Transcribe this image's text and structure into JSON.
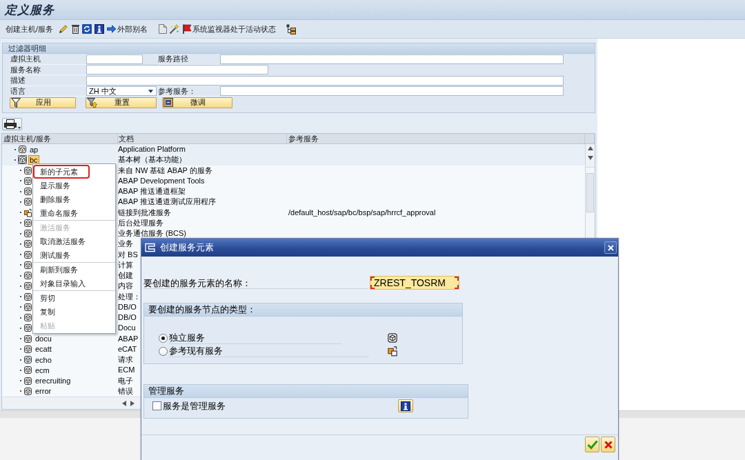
{
  "window": {
    "title": "定义服务"
  },
  "toolbar": {
    "create": "创建主机/服务",
    "external_alias": "外部别名",
    "monitor_status": "系统监视器处于活动状态"
  },
  "filter": {
    "title": "过滤器明细",
    "virtual_host": {
      "label": "虚拟主机"
    },
    "service_path": {
      "label": "服务路径"
    },
    "service_name": {
      "label": "服务名称"
    },
    "description": {
      "label": "描述"
    },
    "language": {
      "label": "语言",
      "value": "ZH 中文"
    },
    "reference_service": {
      "label": "参考服务："
    },
    "buttons": [
      {
        "kind": "apply",
        "label": "应用"
      },
      {
        "kind": "reset",
        "label": "重置"
      },
      {
        "kind": "tune",
        "label": "微调"
      }
    ]
  },
  "tree": {
    "columns": [
      "虚拟主机/服务",
      "文档",
      "参考服务"
    ],
    "rows": [
      {
        "name": "ap",
        "doc": "Application Platform",
        "kind": "service",
        "selected": false
      },
      {
        "name": "bc",
        "doc": "基本树（基本功能）",
        "kind": "service",
        "selected": true,
        "children": [
          {
            "kind": "service",
            "doc": "来自 NW 基础 ABAP 的服务",
            "selected": false
          },
          {
            "kind": "service",
            "doc": "ABAP Development Tools",
            "selected": false
          },
          {
            "kind": "service",
            "doc": "ABAP 推送通道框架",
            "selected": false
          },
          {
            "kind": "service",
            "doc": "ABAP 推送通道测试应用程序",
            "selected": false
          },
          {
            "kind": "reference",
            "doc": "链接到批准服务",
            "reference": "/default_host/sap/bc/bsp/sap/hrrcf_approval",
            "selected": false
          },
          {
            "kind": "service",
            "doc": "后台处理服务",
            "selected": false
          },
          {
            "kind": "service",
            "doc": "业务通信服务 (BCS)",
            "selected": false
          },
          {
            "kind": "service",
            "doc": "业务",
            "selected": false
          },
          {
            "kind": "service",
            "doc": "对 BS",
            "selected": false
          },
          {
            "kind": "service",
            "doc": "计算",
            "selected": false
          },
          {
            "kind": "service",
            "doc": "创建",
            "selected": false
          },
          {
            "kind": "service",
            "doc": "内容",
            "selected": false
          },
          {
            "kind": "service",
            "doc": "处理：",
            "selected": false
          },
          {
            "kind": "service",
            "doc": "DB/O",
            "selected": false
          },
          {
            "kind": "service",
            "doc": "DB/O",
            "selected": false
          },
          {
            "kind": "service",
            "doc": "Docu",
            "selected": false
          },
          {
            "name": "docu",
            "kind": "service",
            "doc": "ABAP",
            "selected": false
          },
          {
            "name": "ecatt",
            "kind": "service",
            "doc": "eCAT",
            "selected": false
          },
          {
            "name": "echo",
            "kind": "service",
            "doc": "请求",
            "selected": false
          },
          {
            "name": "ecm",
            "kind": "service",
            "doc": "ECM",
            "selected": false
          },
          {
            "name": "erecruiting",
            "kind": "service",
            "doc": "电子",
            "selected": false
          },
          {
            "name": "error",
            "kind": "service",
            "doc": "错误",
            "selected": false
          }
        ]
      }
    ]
  },
  "context_menu": {
    "groups": [
      [
        {
          "label": "新的子元素",
          "disabled": false,
          "selected": true
        },
        {
          "label": "显示服务",
          "disabled": false,
          "selected": false
        },
        {
          "label": "删除服务",
          "disabled": false,
          "selected": false
        },
        {
          "label": "重命名服务",
          "disabled": false,
          "selected": false
        }
      ],
      [
        {
          "label": "激活服务",
          "disabled": true,
          "selected": false
        },
        {
          "label": "取消激活服务",
          "disabled": false,
          "selected": false
        },
        {
          "label": "测试服务",
          "disabled": false,
          "selected": false
        }
      ],
      [
        {
          "label": "刷新到服务",
          "disabled": false,
          "selected": false
        },
        {
          "label": "对象目录输入",
          "disabled": false,
          "selected": false
        }
      ],
      [
        {
          "label": "剪切",
          "disabled": false,
          "selected": false
        },
        {
          "label": "复制",
          "disabled": false,
          "selected": false
        },
        {
          "label": "粘贴",
          "disabled": true,
          "selected": false
        }
      ]
    ]
  },
  "dialog": {
    "title": "创建服务元素",
    "name_field": {
      "label": "要创建的服务元素的名称：",
      "value": "ZREST_TOSRM",
      "focused": true
    },
    "type_group": {
      "title": "要创建的服务节点的类型：",
      "options": [
        {
          "label": "独立服务",
          "kind": "service",
          "selected": true
        },
        {
          "label": "参考现有服务",
          "kind": "reference",
          "selected": false
        }
      ]
    },
    "admin_group": {
      "title": "管理服务",
      "checkbox": {
        "label": "服务是管理服务",
        "checked": false
      }
    }
  }
}
